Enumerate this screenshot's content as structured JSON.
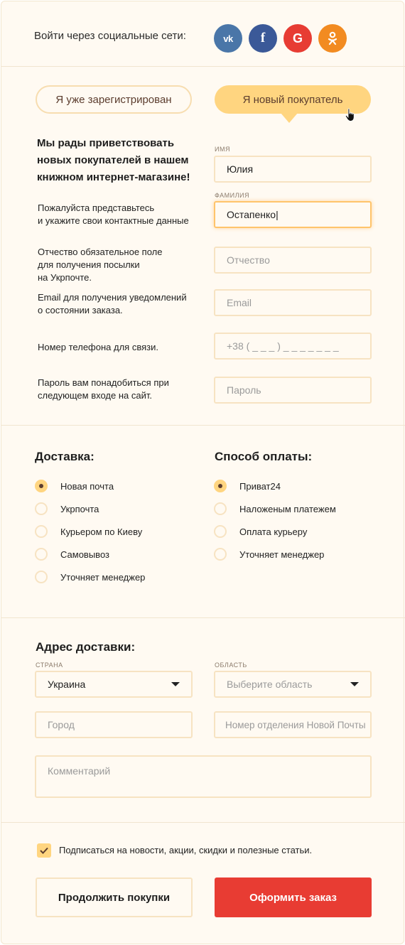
{
  "social": {
    "label": "Войти через социальные сети:",
    "vk_text": "vk",
    "fb_text": "f",
    "google_text": "G",
    "ok_text": "ок",
    "colors": {
      "vk": "#4a76a8",
      "fb": "#3b5998",
      "google": "#e73c33",
      "ok": "#f28b21"
    }
  },
  "tabs": {
    "registered": "Я уже зарегистрирован",
    "new_customer": "Я новый покупатель"
  },
  "welcome": "Мы рады приветствовать новых покупателей в нашем книжном интернет-магазине!",
  "hints": {
    "name": "Пожалуйста представьтесь\nи укажите свои контактные данные",
    "patronymic": "Отчество обязательное поле\nдля получения посылки\nна Укрпочте.",
    "email": "Email для получения уведомлений\nо состоянии заказа.",
    "phone": "Номер телефона для связи.",
    "password": "Пароль вам понадобиться при\nследующем входе на сайт."
  },
  "fields": {
    "name_label": "ИМЯ",
    "name_value": "Юлия",
    "surname_label": "ФАМИЛИЯ",
    "surname_value": "Остапенко|",
    "patronymic_placeholder": "Отчество",
    "email_placeholder": "Email",
    "phone_placeholder": "+38 ( _ _ _ ) _ _ _  _ _  _ _",
    "password_placeholder": "Пароль"
  },
  "delivery": {
    "title": "Доставка:",
    "options": [
      "Новая почта",
      "Укрпочта",
      "Курьером по Киеву",
      "Самовывоз",
      "Уточняет менеджер"
    ],
    "selected_index": 0
  },
  "payment": {
    "title": "Способ оплаты:",
    "options": [
      "Приват24",
      "Наложеным платежем",
      "Оплата курьеру",
      "Уточняет менеджер"
    ],
    "selected_index": 0
  },
  "address": {
    "title": "Адрес доставки:",
    "country_label": "СТРАНА",
    "country_value": "Украина",
    "region_label": "ОБЛАСТЬ",
    "region_placeholder": "Выберите область",
    "city_placeholder": "Город",
    "branch_placeholder": "Номер отделения Новой Почты",
    "comment_placeholder": "Комментарий"
  },
  "subscribe": {
    "label": "Подписаться на новости, акции, скидки и полезные статьи.",
    "checked": true
  },
  "buttons": {
    "continue": "Продолжить покупки",
    "order": "Оформить заказ"
  }
}
